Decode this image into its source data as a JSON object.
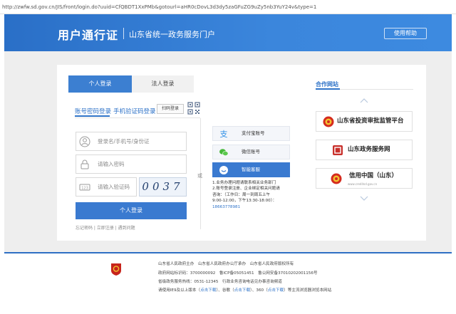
{
  "browser": {
    "url": "http://zwfw.sd.gov.cn/JIS/front/login.do?uuid=CfQBDT1XxPMb&gotourl=aHR0cDovL3d3dy5zaGFuZG9uZy5nb3YuY24v&type=1"
  },
  "header": {
    "title": "用户通行证",
    "subtitle": "山东省统一政务服务门户",
    "help_label": "使用帮助"
  },
  "login": {
    "tabs": [
      {
        "label": "个人登录",
        "active": true
      },
      {
        "label": "法人登录",
        "active": false
      }
    ],
    "subtabs": [
      {
        "label": "账号密码登录",
        "active": true
      },
      {
        "label": "手机验证码登录",
        "active": false
      }
    ],
    "qr_label": "扫码登录",
    "username_placeholder": "登录名/手机号/身份证",
    "password_placeholder": "请输入密码",
    "captcha_placeholder": "请输入验证码",
    "captcha_code": "0037",
    "submit_label": "个人登录",
    "links": "忘记密码 | 立即注册 | 遇到问题"
  },
  "alt_login": {
    "or_label": "或",
    "alipay_label": "支付宝账号",
    "wechat_label": "微信账号",
    "service_label": "智能客服",
    "note1": "1.业务办理问题请联系相关业务部门",
    "note2": "2.账号登录注册、企业绑定相关问题请",
    "note3": "咨询：（工作日：周一到周五上午",
    "note4": "9:00-12:00，下午13:30-18:00）：",
    "phone": "18663778981"
  },
  "partners": {
    "title": "合作网站",
    "sites": [
      {
        "name": "山东省投资审批监管平台"
      },
      {
        "name": "山东政务服务网"
      },
      {
        "name": "信用中国（山东）",
        "url": "www.creditsd.gov.cn"
      }
    ]
  },
  "footer": {
    "line1": "山东省人民政府主办　山东省人民政府办公厅承办　山东省人民政府版权所有",
    "line2": "政府网站标识码：3700000092　鲁ICP备05051451　鲁公网安备37010202001156号",
    "line3": "省级政务服务热线：0531-12345　行政业务咨询电话见办事咨询频道",
    "line4_pre": "请使用IE9及以上版本（",
    "dl1": "点击下载",
    "line4_mid1": "）、谷歌（",
    "dl2": "点击下载",
    "line4_mid2": "）、360（",
    "dl3": "点击下载",
    "line4_post": "）等主流浏览器浏览本网站"
  },
  "colors": {
    "brand_blue": "#3a7ad0",
    "header_blue": "#3b86dc",
    "link_blue": "#2f73c8",
    "backdrop": "#eeeeee"
  }
}
